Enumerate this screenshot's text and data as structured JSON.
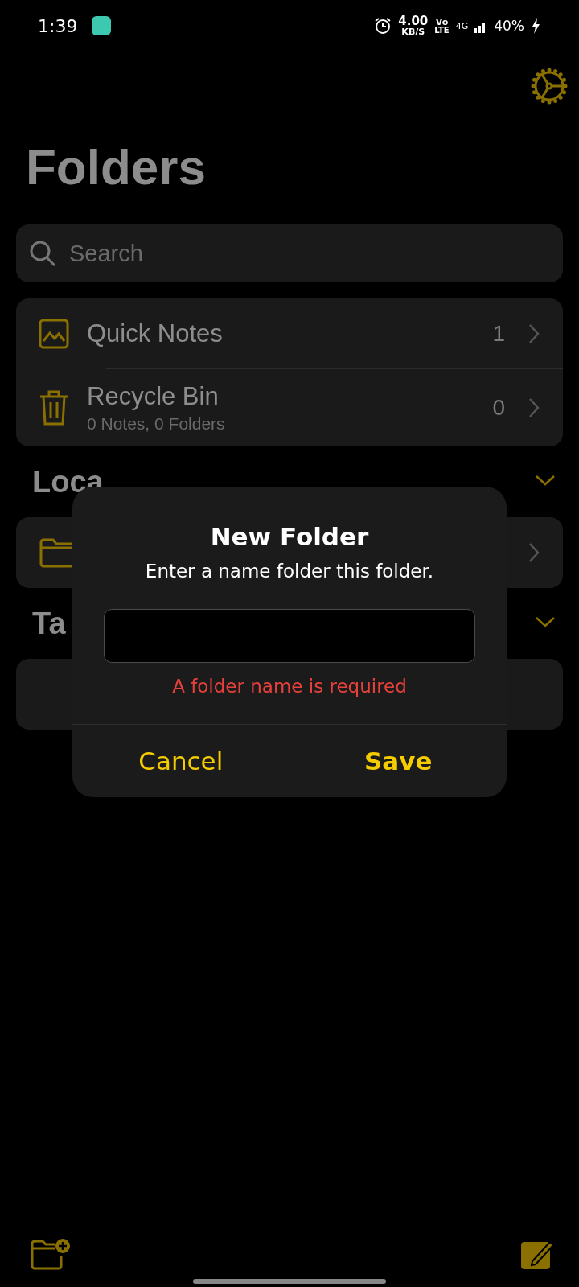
{
  "status_bar": {
    "time": "1:39",
    "speed_value": "4.00",
    "speed_unit": "KB/S",
    "volte_top": "Vo",
    "volte_bottom": "LTE",
    "network": "4G",
    "battery": "40%"
  },
  "title": "Folders",
  "search": {
    "placeholder": "Search"
  },
  "system_folders": [
    {
      "kind": "notes",
      "name": "Quick Notes",
      "count": "1"
    },
    {
      "kind": "bin",
      "name": "Recycle Bin",
      "subtitle": "0 Notes, 0 Folders",
      "count": "0"
    }
  ],
  "sections": [
    {
      "title": "Loca",
      "expanded": true,
      "rows": [
        {
          "kind": "folder"
        }
      ]
    },
    {
      "title": "Ta",
      "expanded": true
    }
  ],
  "dialog": {
    "title": "New Folder",
    "message": "Enter a name folder this folder.",
    "error": "A folder name is required",
    "buttons": [
      {
        "label": "Cancel",
        "primary": false
      },
      {
        "label": "Save",
        "primary": true
      }
    ]
  }
}
